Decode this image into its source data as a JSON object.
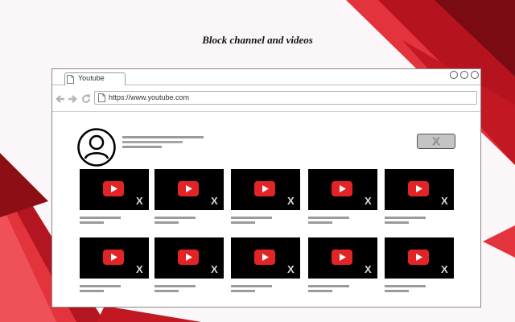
{
  "headline": "Block channel and videos",
  "browser": {
    "tab_label": "Youtube",
    "address_url": "https://www.youtube.com"
  },
  "channel": {
    "block_button_label": "X"
  },
  "video_grid": {
    "rows": 2,
    "columns": 5,
    "remove_label": "X"
  },
  "colors": {
    "accent_red": "#e32426",
    "dark_red": "#a3111a",
    "thumbnail_bg": "#000000"
  }
}
